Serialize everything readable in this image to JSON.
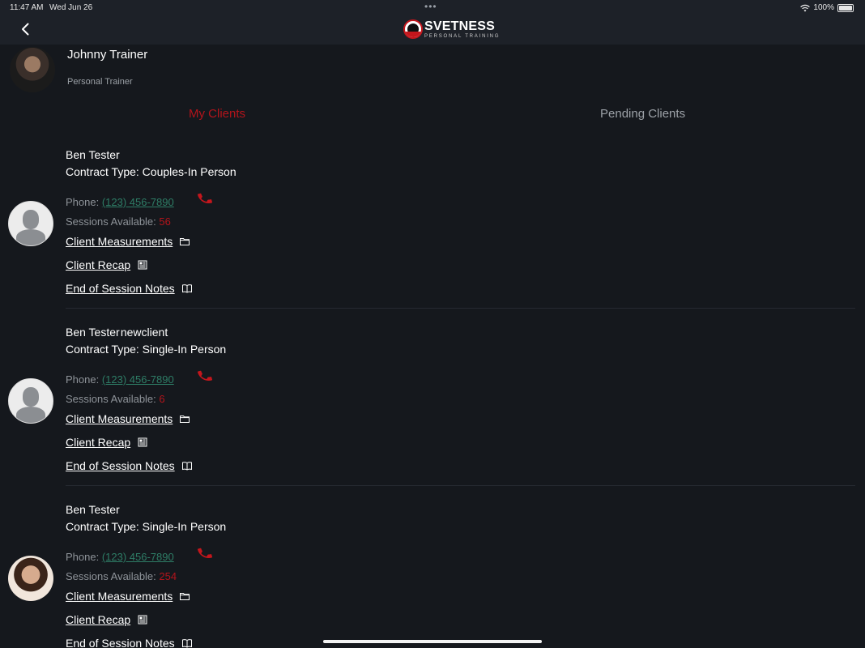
{
  "status": {
    "time": "11:47 AM",
    "date": "Wed Jun 26",
    "battery": "100%"
  },
  "header": {
    "logo_name": "SVETNESS",
    "logo_sub": "PERSONAL TRAINING",
    "back_icon": "chevron-left-icon"
  },
  "trainer": {
    "name": "Johnny Trainer",
    "role": "Personal Trainer"
  },
  "tabs": [
    {
      "label": "My Clients",
      "active": true
    },
    {
      "label": "Pending Clients",
      "active": false
    }
  ],
  "labels": {
    "phone": "Phone: ",
    "sessions": "Sessions Available: ",
    "measurements": "Client Measurements",
    "recap": "Client Recap",
    "notes": "End of Session Notes"
  },
  "clients": [
    {
      "name": "Ben Tester",
      "contract": "Contract Type: Couples-In Person",
      "phone": "(123) 456-7890",
      "sessions": "56",
      "avatar": "placeholder"
    },
    {
      "name": "Ben Tester newclient",
      "contract": "Contract Type: Single-In Person",
      "phone": "(123) 456-7890",
      "sessions": "6",
      "avatar": "placeholder"
    },
    {
      "name": "Ben Tester",
      "contract": "Contract Type: Single-In Person",
      "phone": "(123) 456-7890",
      "sessions": "254",
      "avatar": "photo"
    }
  ],
  "colors": {
    "accent": "#b3141b",
    "link_green": "#2e7d66",
    "background": "#15181d",
    "bar": "#1d2128"
  }
}
